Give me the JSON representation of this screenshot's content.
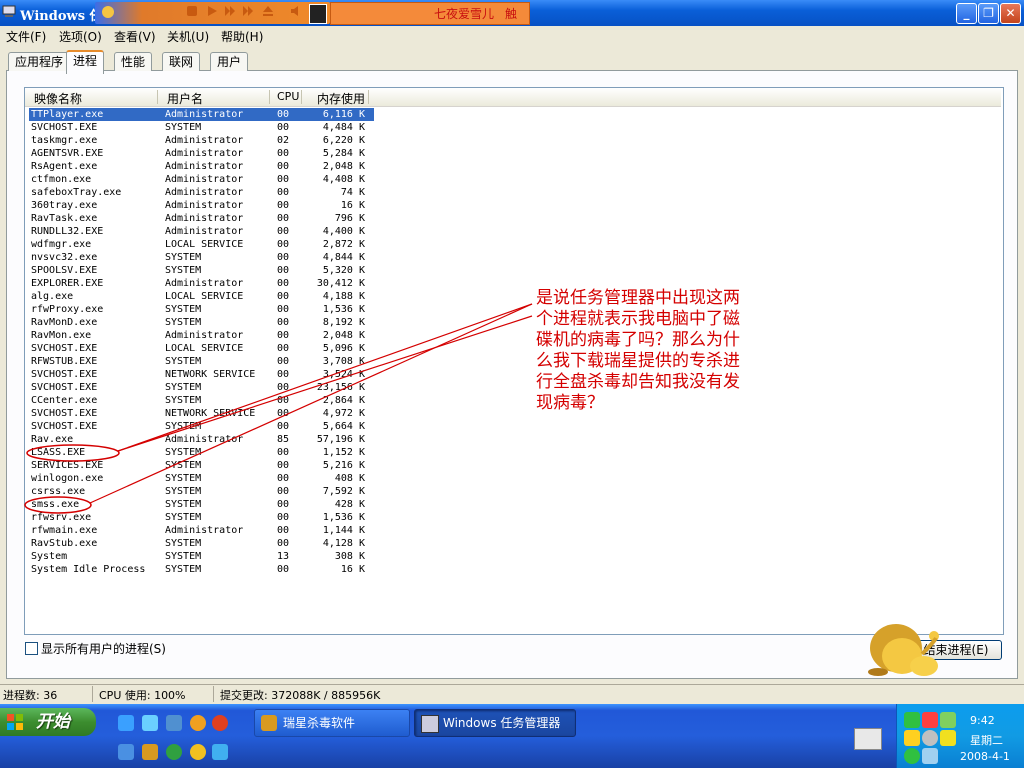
{
  "window": {
    "title": "Windows 任"
  },
  "player": {
    "marquee_text": "七夜爱雪儿",
    "marquee_text2": "触"
  },
  "menu": [
    {
      "label": "文件(F)"
    },
    {
      "label": "选项(O)"
    },
    {
      "label": "查看(V)"
    },
    {
      "label": "关机(U)"
    },
    {
      "label": "帮助(H)"
    }
  ],
  "tabs": [
    {
      "label": "应用程序"
    },
    {
      "label": "进程",
      "active": true
    },
    {
      "label": "性能"
    },
    {
      "label": "联网"
    },
    {
      "label": "用户"
    }
  ],
  "columns": {
    "name": "映像名称",
    "user": "用户名",
    "cpu": "CPU",
    "mem": "内存使用"
  },
  "processes": [
    [
      "TTPlayer.exe",
      "Administrator",
      "00",
      "6,116 K"
    ],
    [
      "SVCHOST.EXE",
      "SYSTEM",
      "00",
      "4,484 K"
    ],
    [
      "taskmgr.exe",
      "Administrator",
      "02",
      "6,220 K"
    ],
    [
      "AGENTSVR.EXE",
      "Administrator",
      "00",
      "5,284 K"
    ],
    [
      "RsAgent.exe",
      "Administrator",
      "00",
      "2,048 K"
    ],
    [
      "ctfmon.exe",
      "Administrator",
      "00",
      "4,408 K"
    ],
    [
      "safeboxTray.exe",
      "Administrator",
      "00",
      "74 K"
    ],
    [
      "360tray.exe",
      "Administrator",
      "00",
      "16 K"
    ],
    [
      "RavTask.exe",
      "Administrator",
      "00",
      "796 K"
    ],
    [
      "RUNDLL32.EXE",
      "Administrator",
      "00",
      "4,400 K"
    ],
    [
      "wdfmgr.exe",
      "LOCAL SERVICE",
      "00",
      "2,872 K"
    ],
    [
      "nvsvc32.exe",
      "SYSTEM",
      "00",
      "4,844 K"
    ],
    [
      "SPOOLSV.EXE",
      "SYSTEM",
      "00",
      "5,320 K"
    ],
    [
      "EXPLORER.EXE",
      "Administrator",
      "00",
      "30,412 K"
    ],
    [
      "alg.exe",
      "LOCAL SERVICE",
      "00",
      "4,188 K"
    ],
    [
      "rfwProxy.exe",
      "SYSTEM",
      "00",
      "1,536 K"
    ],
    [
      "RavMonD.exe",
      "SYSTEM",
      "00",
      "8,192 K"
    ],
    [
      "RavMon.exe",
      "Administrator",
      "00",
      "2,048 K"
    ],
    [
      "SVCHOST.EXE",
      "LOCAL SERVICE",
      "00",
      "5,096 K"
    ],
    [
      "RFWSTUB.EXE",
      "SYSTEM",
      "00",
      "3,708 K"
    ],
    [
      "SVCHOST.EXE",
      "NETWORK SERVICE",
      "00",
      "3,524 K"
    ],
    [
      "SVCHOST.EXE",
      "SYSTEM",
      "00",
      "23,156 K"
    ],
    [
      "CCenter.exe",
      "SYSTEM",
      "00",
      "2,864 K"
    ],
    [
      "SVCHOST.EXE",
      "NETWORK SERVICE",
      "00",
      "4,972 K"
    ],
    [
      "SVCHOST.EXE",
      "SYSTEM",
      "00",
      "5,664 K"
    ],
    [
      "Rav.exe",
      "Administrator",
      "85",
      "57,196 K"
    ],
    [
      "LSASS.EXE",
      "SYSTEM",
      "00",
      "1,152 K"
    ],
    [
      "SERVICES.EXE",
      "SYSTEM",
      "00",
      "5,216 K"
    ],
    [
      "winlogon.exe",
      "SYSTEM",
      "00",
      "408 K"
    ],
    [
      "csrss.exe",
      "SYSTEM",
      "00",
      "7,592 K"
    ],
    [
      "smss.exe",
      "SYSTEM",
      "00",
      "428 K"
    ],
    [
      "rfwsrv.exe",
      "SYSTEM",
      "00",
      "1,536 K"
    ],
    [
      "rfwmain.exe",
      "Administrator",
      "00",
      "1,144 K"
    ],
    [
      "RavStub.exe",
      "SYSTEM",
      "00",
      "4,128 K"
    ],
    [
      "System",
      "SYSTEM",
      "13",
      "308 K"
    ],
    [
      "System Idle Process",
      "SYSTEM",
      "00",
      "16 K"
    ]
  ],
  "footer": {
    "show_all_label": "显示所有用户的进程(S)",
    "end_process_label": "结束进程(E)"
  },
  "status": {
    "processes": "进程数: 36",
    "cpu": "CPU 使用: 100%",
    "commit": "提交更改: 372088K / 885956K"
  },
  "taskbar": {
    "start_label": "开始",
    "task1": "瑞星杀毒软件",
    "task2": "Windows 任务管理器",
    "time": "9:42",
    "day": "星期二",
    "date": "2008-4-1"
  },
  "annotation": "是说任务管理器中出现这两个进程就表示我电脑中了磁碟机的病毒了吗？那么为什么我下载瑞星提供的专杀进行全盘杀毒却告知我没有发现病毒？",
  "colors": {
    "selection": "#316ac5",
    "annotation": "#d40000",
    "titlebar": "#0a5fd8"
  }
}
